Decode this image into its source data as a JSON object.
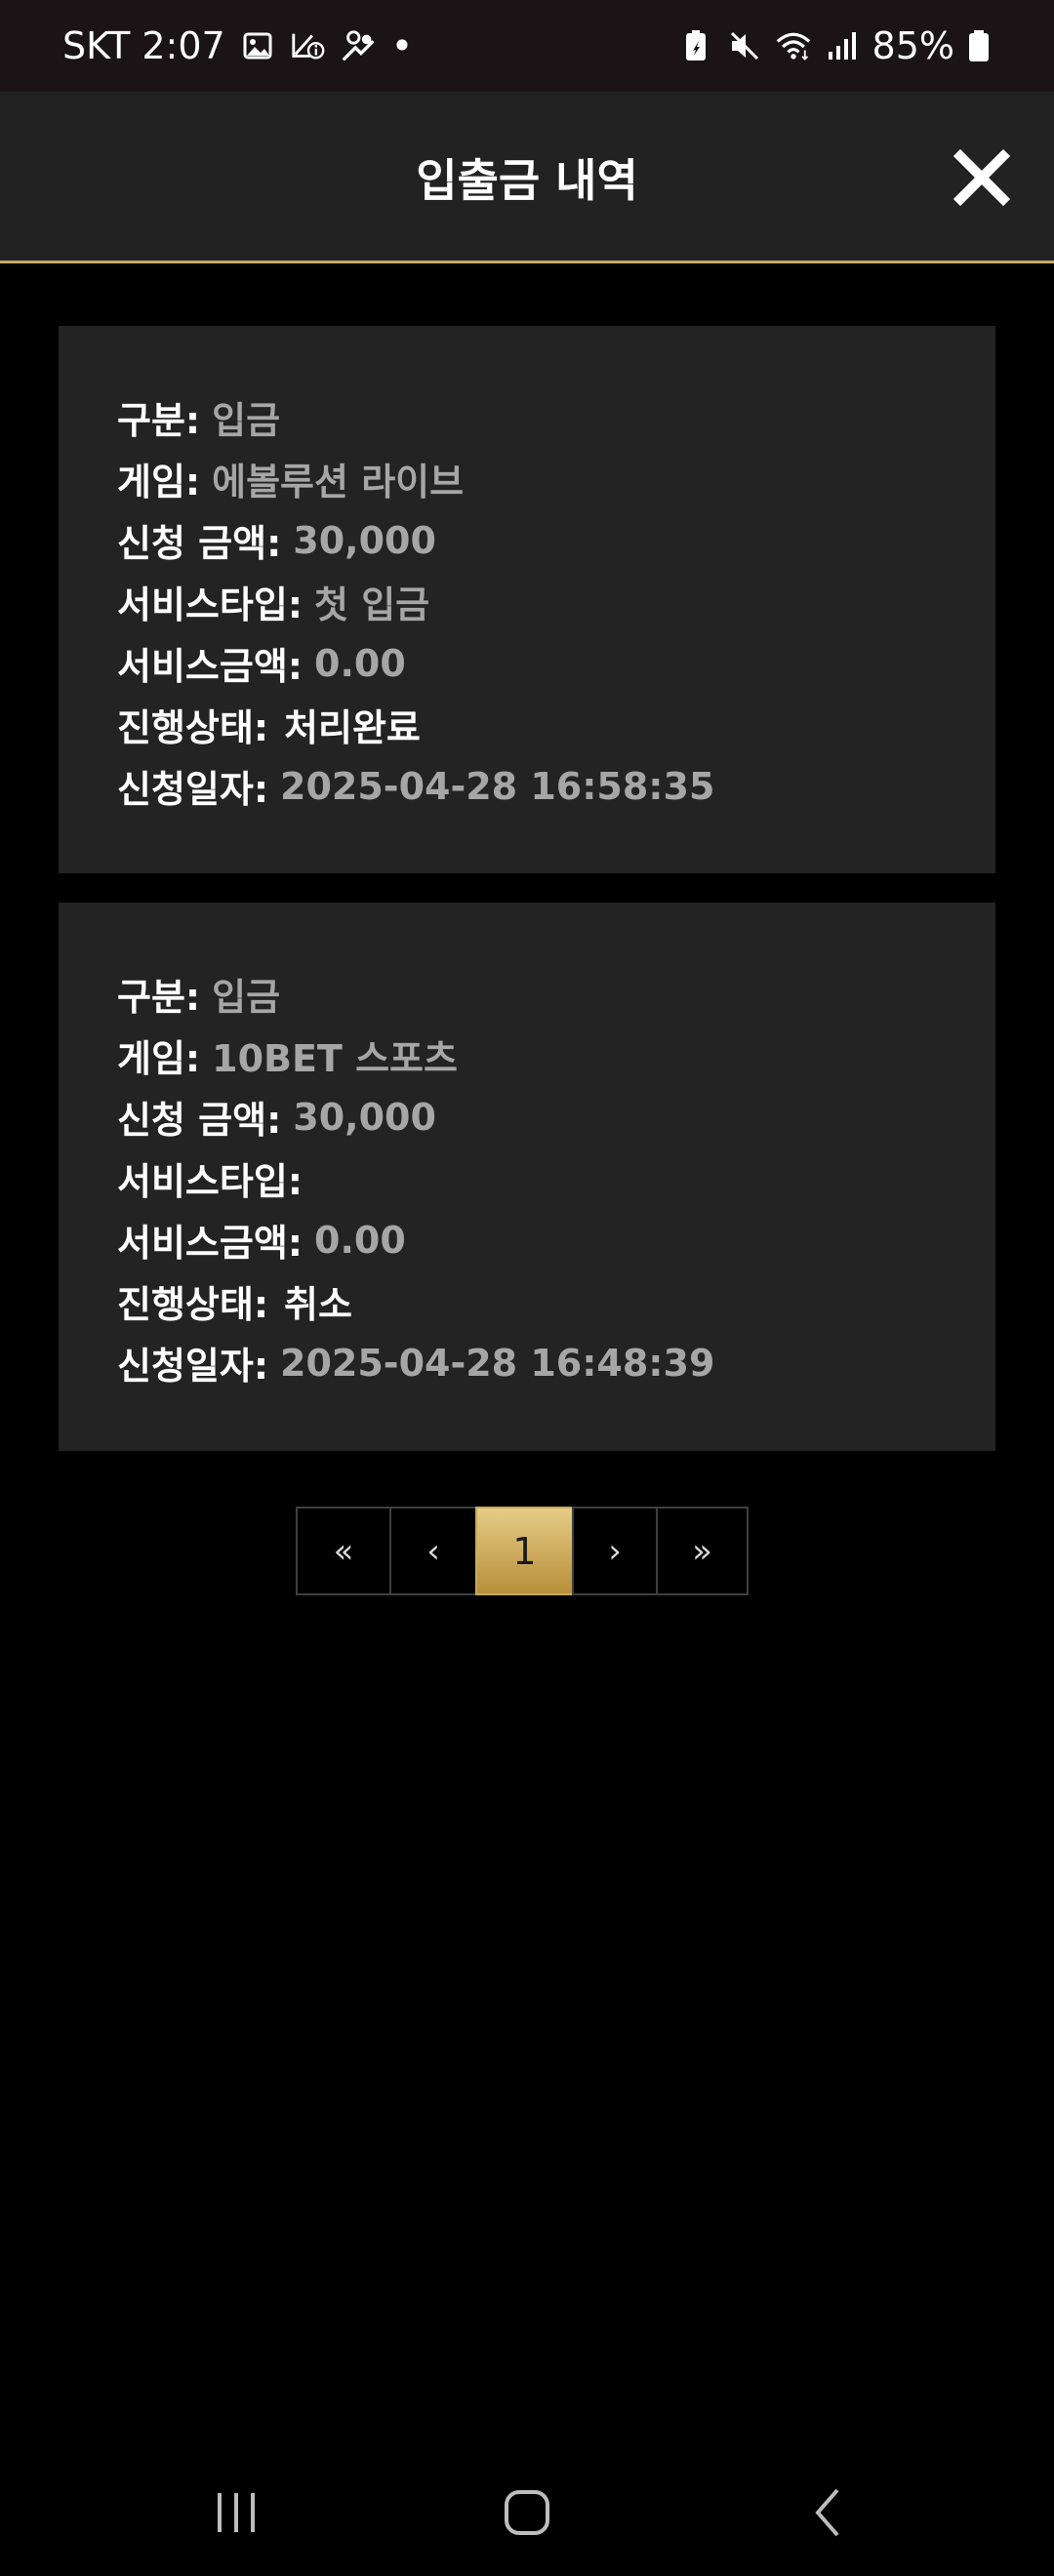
{
  "status_bar": {
    "carrier_time": "SKT 2:07",
    "dot": "•",
    "battery": "85%",
    "icons_left": [
      "gallery-icon",
      "missed-call-icon",
      "gesture-icon"
    ],
    "icons_right": [
      "battery-saver-icon",
      "mute-icon",
      "wifi-icon",
      "signal-icon",
      "battery-icon"
    ]
  },
  "header": {
    "title": "입출금 내역",
    "close_icon": "close-icon"
  },
  "records": [
    {
      "type_label": "구분:",
      "type_value": "입금",
      "game_label": "게임:",
      "game_value": "에볼루션 라이브",
      "amount_label": "신청 금액:",
      "amount_value": "30,000",
      "service_type_label": "서비스타입:",
      "service_type_value": "첫 입금",
      "service_amount_label": "서비스금액:",
      "service_amount_value": "0.00",
      "status_label": "진행상태:",
      "status_value": "처리완료",
      "date_label": "신청일자:",
      "date_value": "2025-04-28 16:58:35"
    },
    {
      "type_label": "구분:",
      "type_value": "입금",
      "game_label": "게임:",
      "game_value": "10BET 스포츠",
      "amount_label": "신청 금액:",
      "amount_value": "30,000",
      "service_type_label": "서비스타입:",
      "service_type_value": "",
      "service_amount_label": "서비스금액:",
      "service_amount_value": "0.00",
      "status_label": "진행상태:",
      "status_value": "취소",
      "date_label": "신청일자:",
      "date_value": "2025-04-28 16:48:39"
    }
  ],
  "pagination": {
    "first": "«",
    "prev": "‹",
    "current": "1",
    "next": "›",
    "last": "»"
  },
  "colors": {
    "accent_gold": "#c7a962",
    "card_bg": "#232323",
    "header_bg": "#222222",
    "value_gray": "#a6a6a6"
  }
}
